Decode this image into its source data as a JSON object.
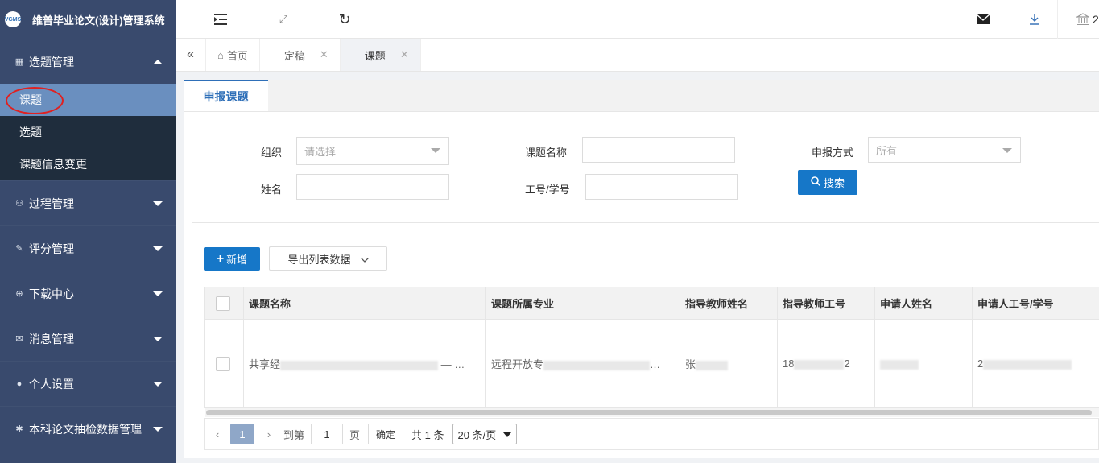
{
  "app": {
    "logo_text": "VGMS",
    "title": "维普毕业论文(设计)管理系统"
  },
  "sidebar": {
    "groups": [
      {
        "label": "选题管理",
        "icon": "grid-icon",
        "expanded": true,
        "items": [
          {
            "label": "课题",
            "active": true
          },
          {
            "label": "选题"
          },
          {
            "label": "课题信息变更"
          }
        ]
      },
      {
        "label": "过程管理",
        "icon": "process-icon"
      },
      {
        "label": "评分管理",
        "icon": "edit-icon"
      },
      {
        "label": "下载中心",
        "icon": "download-circle-icon"
      },
      {
        "label": "消息管理",
        "icon": "mail-icon"
      },
      {
        "label": "个人设置",
        "icon": "user-icon"
      },
      {
        "label": "本科论文抽检数据管理",
        "icon": "gear-icon"
      }
    ]
  },
  "topbar": {
    "user_fragment": "2"
  },
  "tabs": [
    {
      "label": "首页",
      "closable": false
    },
    {
      "label": "定稿",
      "closable": true
    },
    {
      "label": "课题",
      "closable": true,
      "active": true
    }
  ],
  "subtabs": [
    {
      "label": "申报课题",
      "active": true
    }
  ],
  "filters": {
    "org_label": "组织",
    "org_placeholder": "请选择",
    "topic_name_label": "课题名称",
    "topic_name_value": "",
    "apply_method_label": "申报方式",
    "apply_method_value": "所有",
    "name_label": "姓名",
    "name_value": "",
    "id_label": "工号/学号",
    "id_value": "",
    "search_label": "搜索"
  },
  "actions": {
    "add_label": "新增",
    "export_label": "导出列表数据"
  },
  "table": {
    "columns": [
      "课题名称",
      "课题所属专业",
      "指导教师姓名",
      "指导教师工号",
      "申请人姓名",
      "申请人工号/学号"
    ],
    "rows": [
      {
        "topic": "共享经",
        "topic_tail": "— …",
        "major": "远程开放专",
        "major_tail": "…",
        "teacher_name": "张",
        "teacher_id": "18",
        "teacher_id_tail": "2",
        "applicant_name": "",
        "applicant_id": "2"
      }
    ]
  },
  "pagination": {
    "current_page": "1",
    "goto_label": "到第",
    "goto_value": "1",
    "page_unit": "页",
    "confirm_label": "确定",
    "total_label": "共 1 条",
    "page_size": "20 条/页"
  }
}
